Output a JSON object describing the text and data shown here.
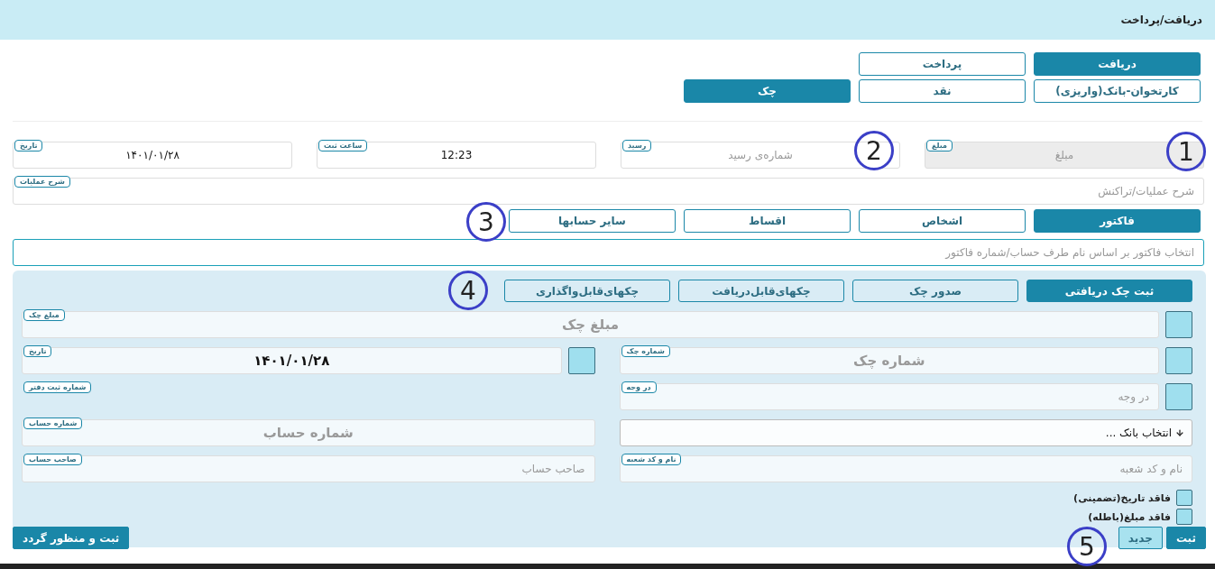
{
  "header": {
    "title": "دریافت/پرداخت"
  },
  "type_buttons": [
    {
      "label": "دریافت",
      "selected": true
    },
    {
      "label": "پرداخت",
      "selected": false
    }
  ],
  "method_buttons": [
    {
      "label": "کارتخوان-بانک(واریزی)",
      "selected": false
    },
    {
      "label": "نقد",
      "selected": false
    },
    {
      "label": "چک",
      "selected": true
    }
  ],
  "fields": [
    {
      "label": "مبلغ",
      "placeholder": "مبلغ",
      "disabled": true
    },
    {
      "label": "رسید",
      "placeholder": "شماره‌ی رسید",
      "disabled": false
    },
    {
      "label": "ساعت ثبت",
      "value": "12:23",
      "disabled": false
    },
    {
      "label": "تاریخ",
      "value": "۱۴۰۱/۰۱/۲۸",
      "disabled": false
    }
  ],
  "description": {
    "label": "شرح عملیات",
    "placeholder": "شرح عملیات/تراکنش"
  },
  "target_tabs": [
    {
      "label": "فاکتور",
      "selected": true
    },
    {
      "label": "اشخاص",
      "selected": false
    },
    {
      "label": "اقساط",
      "selected": false
    },
    {
      "label": "سایر حسابها",
      "selected": false
    }
  ],
  "invoice_search": {
    "placeholder": "انتخاب فاکتور بر اساس نام طرف حساب/شماره فاکتور"
  },
  "check_tabs": [
    {
      "label": "ثبت چک دریافتی",
      "selected": true
    },
    {
      "label": "صدور چک",
      "selected": false
    },
    {
      "label": "چکهای‌قابل‌دریافت",
      "selected": false
    },
    {
      "label": "چکهای‌قابل‌واگذاری",
      "selected": false
    }
  ],
  "check_amount": {
    "label": "مبلغ چک",
    "placeholder": "مبلغ چک",
    "checked": false
  },
  "check_number": {
    "label": "شماره چک",
    "placeholder": "شماره چک",
    "checked": false
  },
  "check_date": {
    "label": "تاریخ",
    "value": "۱۴۰۱/۰۱/۲۸",
    "checked": false
  },
  "payee": {
    "label": "در وجه",
    "placeholder": "در وجه",
    "checked": false
  },
  "ledger_number": {
    "label": "شماره ثبت دفتر"
  },
  "bank_select": {
    "value": "انتخاب بانک ..."
  },
  "account_number": {
    "label": "شماره حساب",
    "placeholder": "شماره حساب"
  },
  "branch": {
    "label": "نام و کد شعبه",
    "placeholder": "نام و کد شعبه"
  },
  "account_owner": {
    "label": "صاحب حساب",
    "placeholder": "صاحب حساب"
  },
  "options": [
    {
      "label": "فاقد تاریخ(تضمینی)",
      "checked": false
    },
    {
      "label": "فاقد مبلغ(باطله)",
      "checked": false
    }
  ],
  "actions": {
    "save": "ثبت",
    "new": "جدید",
    "save_and_post": "ثبت و منظور گردد"
  },
  "callouts": [
    "1",
    "2",
    "3",
    "4",
    "5"
  ]
}
